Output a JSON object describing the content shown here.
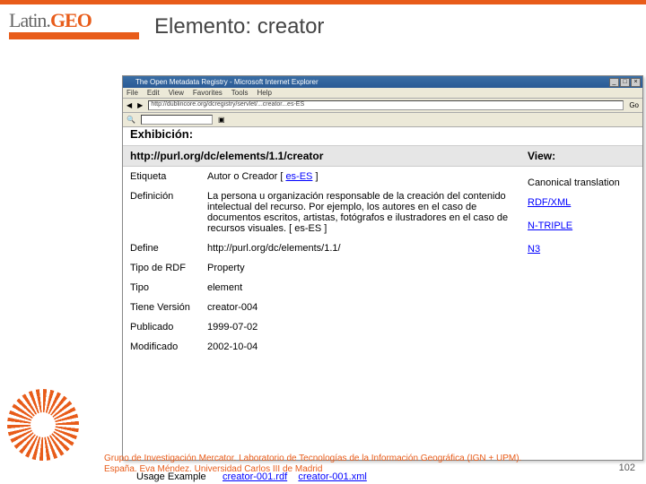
{
  "slide": {
    "title": "Elemento: creator",
    "logo": {
      "main": "Latin.",
      "accent": "GEO"
    },
    "footer_line1": "Grupo de Investigación Mercator. Laboratorio de Tecnologías de la Información Geográfica (IGN + UPM).",
    "footer_line2": "España.  Eva Méndez. Universidad Carlos III de Madrid",
    "number": "102"
  },
  "browser": {
    "title": "The Open Metadata Registry - Microsoft Internet Explorer",
    "menu": [
      "File",
      "Edit",
      "View",
      "Favorites",
      "Tools",
      "Help"
    ],
    "address": "http://dublincore.org/dcregistry/servlet/...creator...es-ES",
    "win_btns": [
      "_",
      "□",
      "×"
    ],
    "go": "Go"
  },
  "page": {
    "exhibicion": "Exhibición:",
    "header_uri": "http://purl.org/dc/elements/1.1/creator",
    "view_label": "View:",
    "rows": [
      {
        "label": "Etiqueta",
        "value": "Autor o Creador [ ",
        "link": "es-ES",
        "after": " ]"
      },
      {
        "label": "Definición",
        "value": "La persona u organización responsable de la creación del contenido intelectual del recurso. Por ejemplo, los autores en el caso de documentos escritos, artistas, fotógrafos e ilustradores en el caso de recursos visuales. [ es-ES ]"
      },
      {
        "label": "Define",
        "value": "http://purl.org/dc/elements/1.1/"
      },
      {
        "label": "Tipo de RDF",
        "value": "Property"
      },
      {
        "label": "Tipo",
        "value": "element"
      },
      {
        "label": "Tiene Versión",
        "value": "creator-004"
      },
      {
        "label": "Publicado",
        "value": "1999-07-02"
      },
      {
        "label": "Modificado",
        "value": "2002-10-04"
      }
    ],
    "views": {
      "canonical": "Canonical translation",
      "rdfxml": "RDF/XML",
      "ntriple": "N-TRIPLE",
      "n3": "N3"
    },
    "usage": {
      "label": "Usage Example",
      "val1": "creator-001.rdf",
      "val2": "creator-001.xml"
    }
  }
}
